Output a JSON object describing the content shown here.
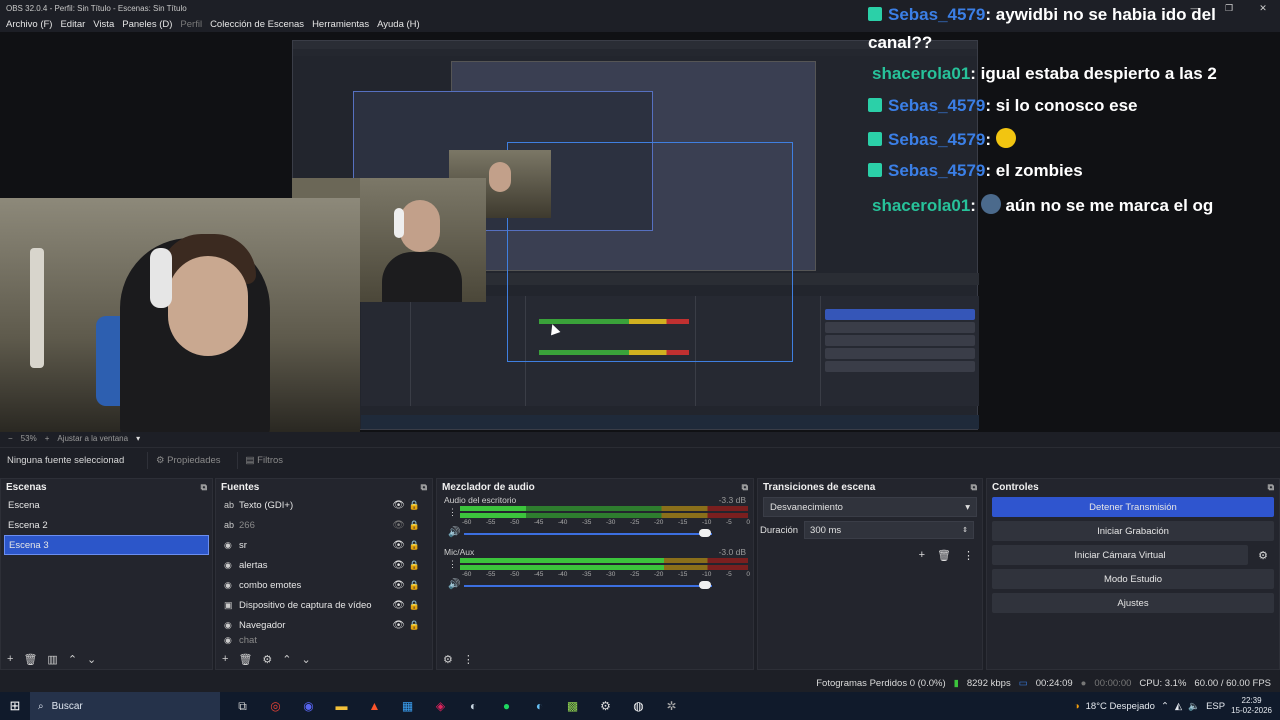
{
  "window": {
    "title": "OBS 32.0.4 - Perfil: Sin Título - Escenas: Sin Título",
    "controls": [
      "—",
      "❐",
      "✕"
    ]
  },
  "menu": {
    "items": [
      "Archivo (F)",
      "Editar",
      "Vista",
      "Paneles (D)",
      "Perfil",
      "Colección de Escenas",
      "Herramientas",
      "Ayuda (H)"
    ]
  },
  "chat": {
    "lines": [
      {
        "user": "Sebas_4579",
        "text": ": aywidbi no se habia ido del",
        "color": "#3b7fe6"
      },
      {
        "user": "",
        "text": "canal??",
        "color": "#ffffff"
      },
      {
        "user": "shacerola01",
        "text": ": igual estaba despierto a las 2",
        "color": "#27c29a"
      },
      {
        "user": "Sebas_4579",
        "text": ": si lo conosco ese",
        "color": "#3b7fe6"
      },
      {
        "user": "Sebas_4579",
        "text": ":",
        "color": "#3b7fe6"
      },
      {
        "user": "Sebas_4579",
        "text": ": el zombies",
        "color": "#3b7fe6"
      },
      {
        "user": "shacerola01",
        "text": ":",
        "color": "#27c29a",
        "tail": "aún no se me marca el og"
      }
    ]
  },
  "zoom": {
    "minus": "−",
    "level": "53%",
    "plus": "+",
    "fit": "Ajustar a la ventana"
  },
  "source_toolbar": {
    "no_selection": "Ninguna fuente seleccionad",
    "properties": "Propiedades",
    "filters": "Filtros"
  },
  "scenes": {
    "title": "Escenas",
    "items": [
      "Escena",
      "Escena 2",
      "Escena 3"
    ],
    "selected": "Escena 3"
  },
  "sources": {
    "title": "Fuentes",
    "items": [
      {
        "label": "Texto (GDI+)",
        "icon": "text-icon"
      },
      {
        "label": "266",
        "icon": "text-icon",
        "dim": true
      },
      {
        "label": "sr",
        "icon": "browser-icon"
      },
      {
        "label": "alertas",
        "icon": "browser-icon"
      },
      {
        "label": "combo emotes",
        "icon": "browser-icon"
      },
      {
        "label": "Dispositivo de captura de vídeo",
        "icon": "camera-icon"
      },
      {
        "label": "Navegador",
        "icon": "browser-icon"
      },
      {
        "label": "chat",
        "icon": "browser-icon",
        "dim": true
      }
    ]
  },
  "mixer": {
    "title": "Mezclador de audio",
    "channels": [
      {
        "name": "Audio del escritorio",
        "db": "-3.3 dB",
        "level": 0.23,
        "fader": 0.97
      },
      {
        "name": "Mic/Aux",
        "db": "-3.0 dB",
        "level": 0.71,
        "fader": 0.97
      }
    ],
    "ticks": [
      "-60",
      "-55",
      "-50",
      "-45",
      "-40",
      "-35",
      "-30",
      "-25",
      "-20",
      "-15",
      "-10",
      "-5",
      "0"
    ]
  },
  "transitions": {
    "title": "Transiciones de escena",
    "selected": "Desvanecimiento",
    "duration_label": "Duración",
    "duration_value": "300 ms"
  },
  "controls": {
    "title": "Controles",
    "stop_stream": "Detener Transmisión",
    "start_record": "Iniciar Grabación",
    "start_vcam": "Iniciar Cámara Virtual",
    "studio_mode": "Modo Estudio",
    "settings": "Ajustes"
  },
  "status": {
    "dropped": "Fotogramas Perdidos 0 (0.0%)",
    "bitrate": "8292 kbps",
    "stream_time": "00:24:09",
    "rec_time": "00:00:00",
    "cpu": "CPU: 3.1%",
    "fps": "60.00 / 60.00 FPS"
  },
  "taskbar": {
    "search": "Buscar",
    "weather": "18°C  Despejado",
    "lang": "ESP",
    "time": "22:39",
    "date": "15-02-2026"
  }
}
